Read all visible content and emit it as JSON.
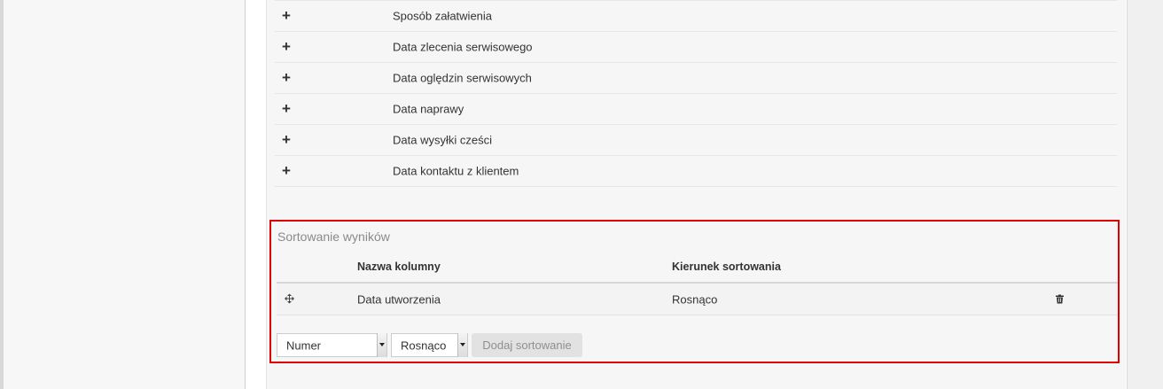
{
  "columns_list": [
    {
      "action": "+",
      "label": "Sposób załatwienia"
    },
    {
      "action": "+",
      "label": "Data zlecenia serwisowego"
    },
    {
      "action": "+",
      "label": "Data oględzin serwisowych"
    },
    {
      "action": "+",
      "label": "Data naprawy"
    },
    {
      "action": "+",
      "label": "Data wysyłki cześci"
    },
    {
      "action": "+",
      "label": "Data kontaktu z klientem"
    }
  ],
  "sorting": {
    "title": "Sortowanie wyników",
    "headers": {
      "column_name": "Nazwa kolumny",
      "direction": "Kierunek sortowania"
    },
    "rows": [
      {
        "column": "Data utworzenia",
        "direction": "Rosnąco"
      }
    ],
    "column_select": "Numer",
    "direction_select": "Rosnąco",
    "add_button": "Dodaj sortowanie"
  },
  "icons": {
    "row_handle": "move-icon",
    "delete": "trash-icon"
  },
  "colors": {
    "highlight": "#e00000",
    "disabled_button_bg": "#e2e2e2"
  }
}
